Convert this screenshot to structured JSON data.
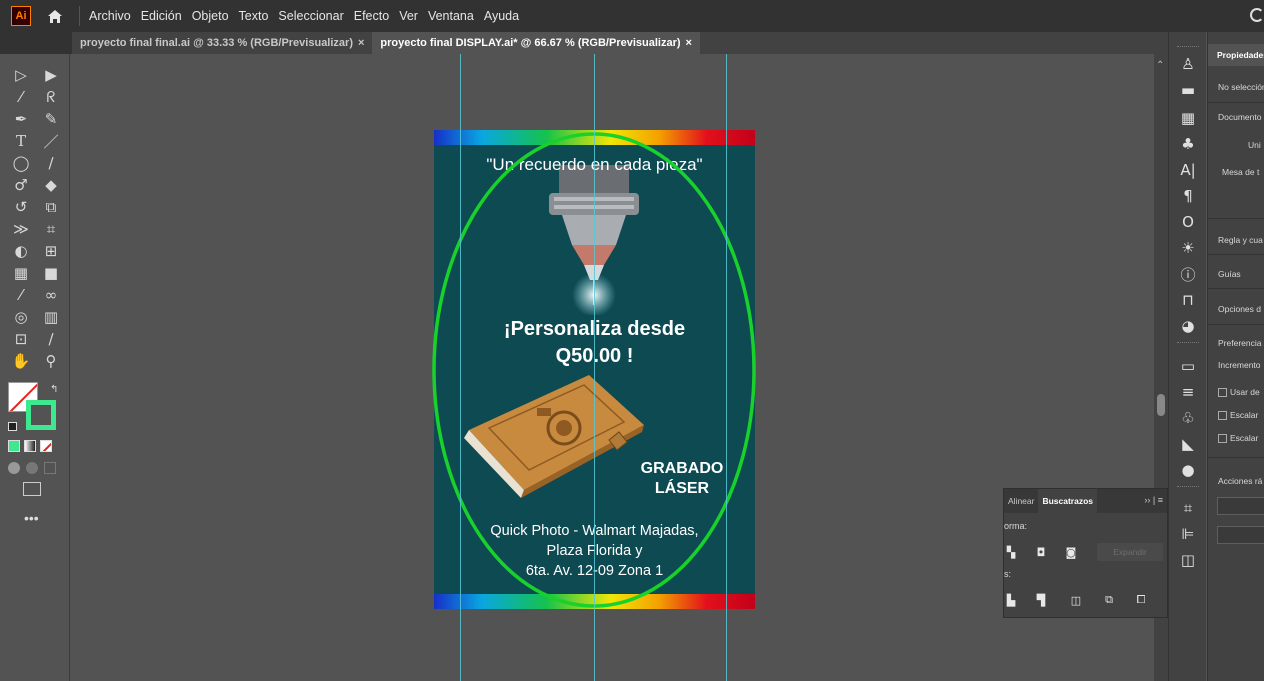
{
  "menubar": {
    "logo": "Ai",
    "items": [
      "Archivo",
      "Edición",
      "Objeto",
      "Texto",
      "Seleccionar",
      "Efecto",
      "Ver",
      "Ventana",
      "Ayuda"
    ]
  },
  "tabs": [
    {
      "label": "proyecto final final.ai @ 33.33 % (RGB/Previsualizar)",
      "close": "×"
    },
    {
      "label": "proyecto final DISPLAY.ai* @ 66.67 % (RGB/Previsualizar)",
      "close": "×"
    }
  ],
  "artboard": {
    "tagline": "\"Un recuerdo en cada pieza\"",
    "headline_line1": "¡Personaliza desde",
    "headline_line2": "Q50.00 !",
    "badge_line1": "GRABADO",
    "badge_line2": "LÁSER",
    "address_line1": "Quick Photo - Walmart Majadas,",
    "address_line2": "Plaza Florida y",
    "address_line3": "6ta. Av. 12-09 Zona 1",
    "background_color": "#0d4a52",
    "ellipse_color": "#19d12b"
  },
  "properties_panel": {
    "tab": "Propiedades",
    "no_selection": "No selección",
    "document": "Documento",
    "units": "Uni",
    "artboards": "Mesa de t",
    "rulers_grids": "Regla y cua",
    "guides": "Guías",
    "snap_options": "Opciones d",
    "preferences": "Preferencia",
    "increment": "Incremento",
    "check1": "Usar de",
    "check2": "Escalar",
    "check3": "Escalar",
    "quick_actions": "Acciones rá"
  },
  "pathfinder_panel": {
    "tab_align": "Alinear",
    "tab_pathfinder": "Buscatrazos",
    "more": "›› | ≡",
    "shape_modes_label": "orma:",
    "pathfinders_label": "s:",
    "expand_button": "Expandir"
  },
  "icons": {
    "home": "home-icon",
    "more_tools": "•••"
  }
}
